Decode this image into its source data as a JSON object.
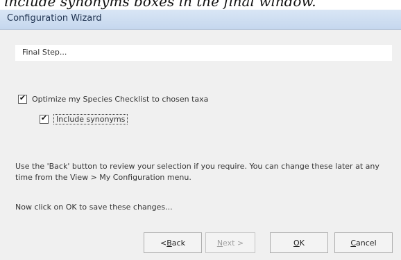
{
  "document_fragment": "include synonyms boxes in the final window.",
  "window": {
    "title": "Configuration Wizard"
  },
  "step_label": "Final Step...",
  "options": {
    "optimize_label": "Optimize my Species Checklist to chosen taxa",
    "optimize_checked": true,
    "synonyms_label": "Include synonyms",
    "synonyms_checked": true
  },
  "info_text": "Use the 'Back' button to review your selection if you require.  You can change these later at any time from the View > My Configuration menu.",
  "save_prompt": "Now click on OK to save these changes...",
  "buttons": {
    "back": {
      "prefix": "< ",
      "accel": "B",
      "rest": "ack",
      "enabled": true
    },
    "next": {
      "prefix": "",
      "accel": "N",
      "rest": "ext >",
      "enabled": false
    },
    "ok": {
      "prefix": "",
      "accel": "O",
      "rest": "K",
      "enabled": true
    },
    "cancel": {
      "prefix": "",
      "accel": "C",
      "rest": "ancel",
      "enabled": true
    }
  },
  "icons": {
    "checkbox_mark": "✔"
  }
}
